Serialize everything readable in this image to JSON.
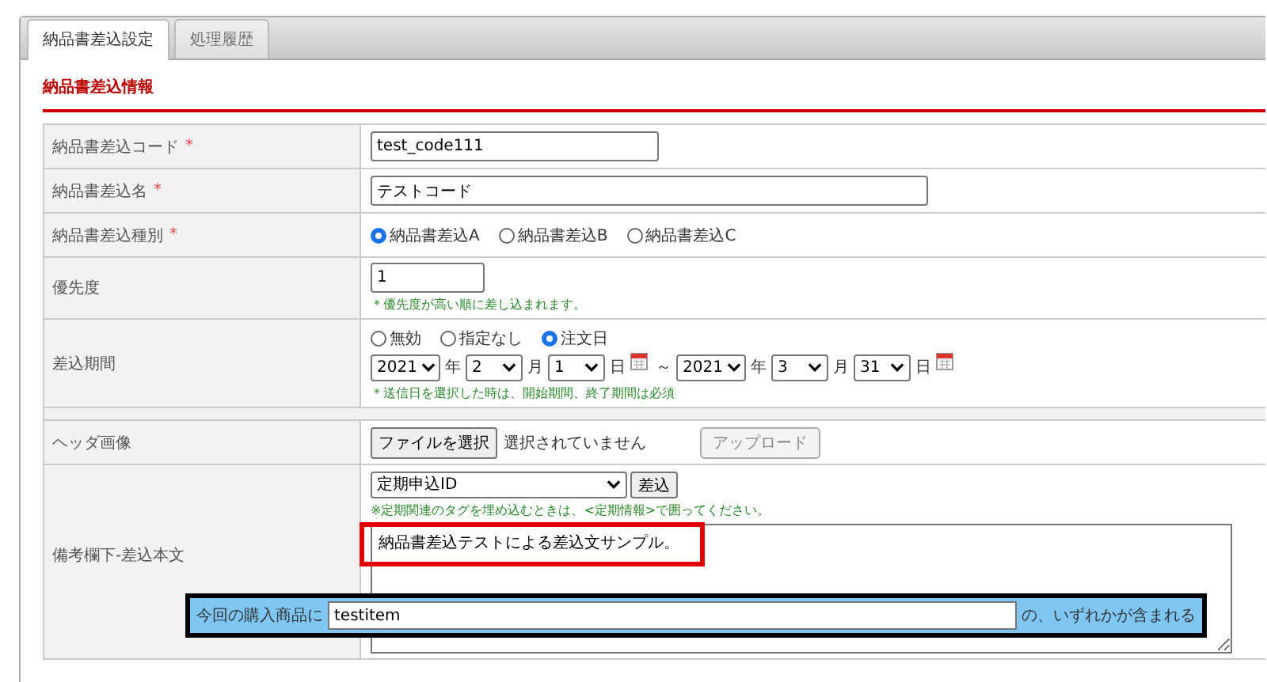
{
  "tabs": [
    {
      "label": "納品書差込設定",
      "selected": true
    },
    {
      "label": "処理履歴",
      "selected": false
    }
  ],
  "section_title": "納品書差込情報",
  "rows": [
    {
      "kind": "text",
      "label": "納品書差込コード",
      "required_mark": "*",
      "wide": false,
      "value": "test_code111"
    },
    {
      "kind": "text",
      "label": "納品書差込名",
      "required_mark": "*",
      "wide": true,
      "value": "テストコード"
    },
    {
      "kind": "radio",
      "label": "納品書差込種別",
      "required_mark": "*",
      "options": [
        {
          "label": "納品書差込A",
          "selected": true
        },
        {
          "label": "納品書差込B",
          "selected": false
        },
        {
          "label": "納品書差込C",
          "selected": false
        }
      ]
    },
    {
      "kind": "number",
      "label": "優先度",
      "value": "1",
      "hint": "＊優先度が高い順に差し込まれます。"
    },
    {
      "kind": "period",
      "label": "差込期間",
      "options": [
        {
          "label": "無効",
          "selected": false
        },
        {
          "label": "指定なし",
          "selected": false
        },
        {
          "label": "注文日",
          "selected": true
        }
      ],
      "start": [
        {
          "value": "2021",
          "unit": "年"
        },
        {
          "value": "2",
          "unit": "月"
        },
        {
          "value": "1",
          "unit": "日"
        }
      ],
      "separator": "～",
      "end": [
        {
          "value": "2021",
          "unit": "年"
        },
        {
          "value": "3",
          "unit": "月"
        },
        {
          "value": "31",
          "unit": "日"
        }
      ],
      "hint": "＊送信日を選択した時は、開始期間、終了期間は必須"
    },
    {
      "kind": "spacer"
    },
    {
      "kind": "file",
      "label": "ヘッダ画像",
      "button": "ファイルを選択",
      "status": "選択されていません",
      "upload": {
        "label": "アップロード",
        "disabled": true
      }
    },
    {
      "kind": "template",
      "label": "備考欄下-差込本文",
      "select": "定期申込ID",
      "insert": "差込",
      "hint": "※定期関連のタグを埋め込むときは、<定期情報>で囲ってください。",
      "text": "納品書差込テストによる差込文サンプル。"
    }
  ],
  "condition_bar": {
    "prefix": "今回の購入商品に",
    "value": "testitem",
    "suffix": "の、いずれかが含まれる"
  }
}
